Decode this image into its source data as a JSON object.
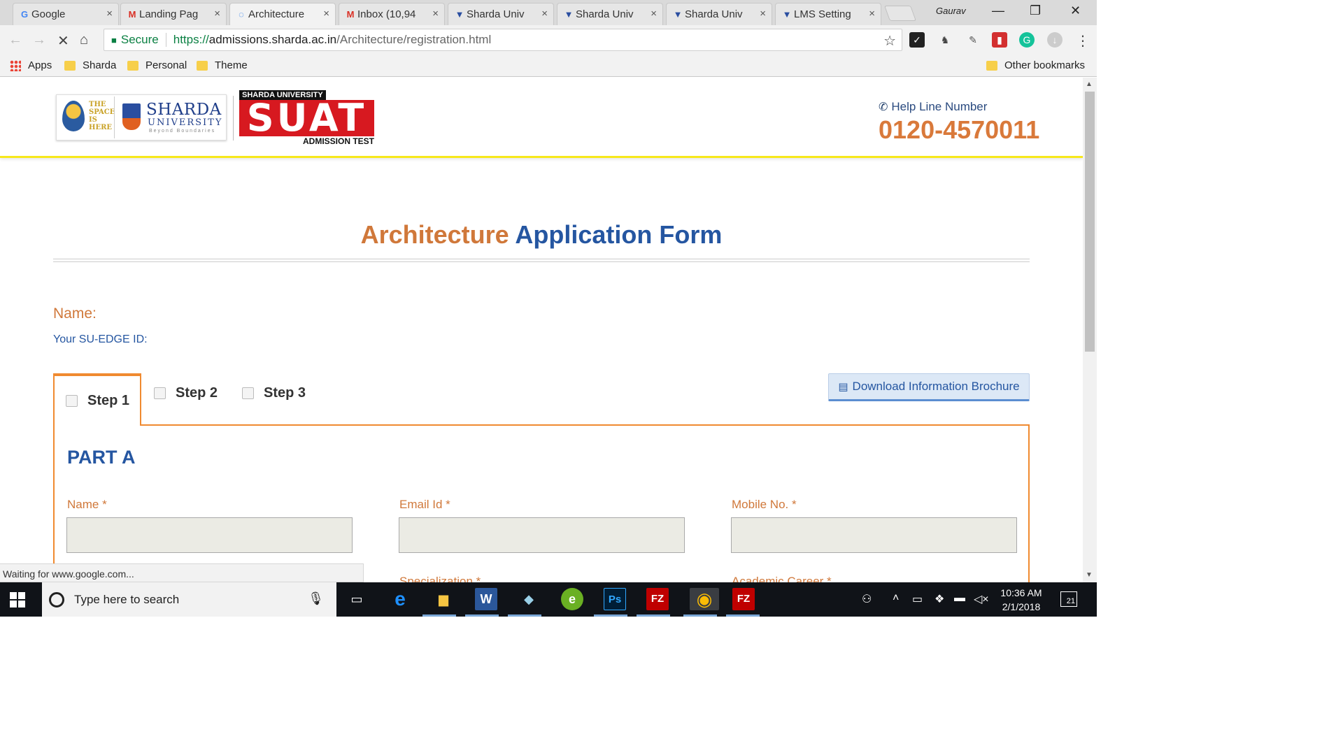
{
  "browser": {
    "tabs": [
      {
        "title": "Google",
        "icon": "G",
        "icon_color": "#4285f4"
      },
      {
        "title": "Landing Pag",
        "icon": "M",
        "icon_color": "#d93025"
      },
      {
        "title": "Architecture",
        "icon": "◌",
        "icon_color": "#1a73e8"
      },
      {
        "title": "Inbox (10,94",
        "icon": "M",
        "icon_color": "#d93025"
      },
      {
        "title": "Sharda Univ",
        "icon": "▼",
        "icon_color": "#2a4ea0"
      },
      {
        "title": "Sharda Univ",
        "icon": "▼",
        "icon_color": "#2a4ea0"
      },
      {
        "title": "Sharda Univ",
        "icon": "▼",
        "icon_color": "#2a4ea0"
      },
      {
        "title": "LMS Setting",
        "icon": "▼",
        "icon_color": "#2a4ea0"
      }
    ],
    "close_glyph": "×",
    "profile_name": "Gaurav",
    "window_controls": [
      "—",
      "❐",
      "✕"
    ],
    "secure_label": "Secure",
    "url_scheme": "https://",
    "url_host": "admissions.sharda.ac.in",
    "url_path": "/Architecture/registration.html",
    "nav": {
      "back": "←",
      "forward": "→",
      "stop": "✕",
      "home": "⌂",
      "star": "☆",
      "menu": "⋮"
    },
    "bookmarks": [
      {
        "label": "Apps"
      },
      {
        "label": "Sharda"
      },
      {
        "label": "Personal"
      },
      {
        "label": "Theme"
      }
    ],
    "other_bookmarks": "Other bookmarks",
    "status_text": "Waiting for www.google.com..."
  },
  "header": {
    "logo_here_text": "THE SPACE IS HERE",
    "logo_brand": "SHARDA",
    "logo_sub": "UNIVERSITY",
    "logo_tagline": "Beyond Boundaries",
    "suat_top": "SHARDA UNIVERSITY",
    "suat_main": "SUAT",
    "suat_bottom": "ADMISSION TEST",
    "helpline_label": "Help Line Number",
    "helpline_number": "0120-4570011"
  },
  "form": {
    "title_part1": "Architecture",
    "title_part2": "Application Form",
    "name_label": "Name:",
    "suedge_label": "Your SU-EDGE ID:",
    "steps": [
      "Step 1",
      "Step 2",
      "Step 3"
    ],
    "brochure_button": "Download Information Brochure",
    "part_title": "PART A",
    "fields": [
      {
        "label": "Name *",
        "value": ""
      },
      {
        "label": "Email Id *",
        "value": ""
      },
      {
        "label": "Mobile No. *",
        "value": ""
      }
    ],
    "next_fields": [
      "Specialization *",
      "Academic Career *"
    ]
  },
  "taskbar": {
    "search_placeholder": "Type here to search",
    "apps": [
      {
        "name": "task-view",
        "glyph": "▭",
        "color": "#ffffff",
        "bg": "transparent"
      },
      {
        "name": "edge",
        "glyph": "e",
        "color": "#1e90ff",
        "bg": "transparent"
      },
      {
        "name": "file-explorer",
        "glyph": "▆",
        "color": "#f5c542",
        "bg": "transparent"
      },
      {
        "name": "word",
        "glyph": "W",
        "color": "#ffffff",
        "bg": "#2b579a"
      },
      {
        "name": "notepad",
        "glyph": "◆",
        "color": "#9ad0e8",
        "bg": "transparent"
      },
      {
        "name": "fence",
        "glyph": "e",
        "color": "#ffffff",
        "bg": "#6ab023"
      },
      {
        "name": "photoshop",
        "glyph": "Ps",
        "color": "#31a8ff",
        "bg": "#001e36"
      },
      {
        "name": "filezilla-1",
        "glyph": "FZ",
        "color": "#ffffff",
        "bg": "#bf0000"
      },
      {
        "name": "chrome",
        "glyph": "◉",
        "color": "#fbbc05",
        "bg": "transparent"
      },
      {
        "name": "filezilla-2",
        "glyph": "FZ",
        "color": "#ffffff",
        "bg": "#bf0000"
      }
    ],
    "time": "10:36 AM",
    "date": "2/1/2018",
    "notifications": "21"
  }
}
